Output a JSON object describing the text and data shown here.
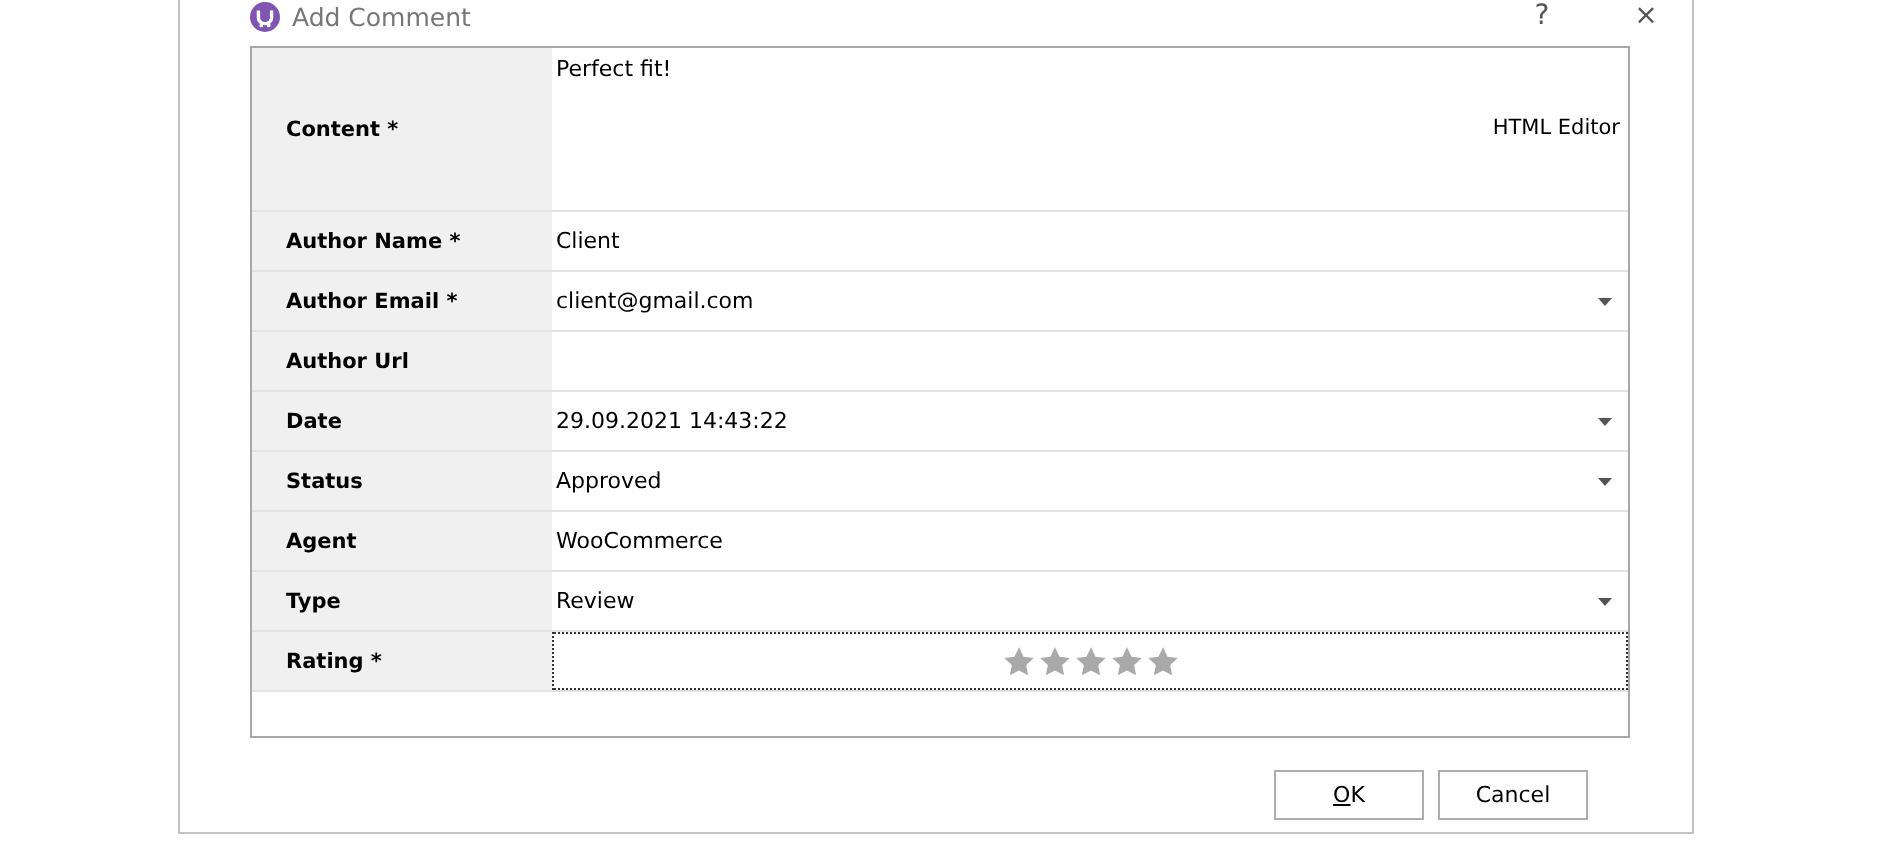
{
  "window": {
    "title": "Add Comment",
    "help": "?",
    "close": "×"
  },
  "content": {
    "label": "Content *",
    "value": "Perfect fit!",
    "editor_link": "HTML Editor"
  },
  "fields": [
    {
      "label": "Author Name *",
      "value": "Client",
      "kind": "text"
    },
    {
      "label": "Author Email *",
      "value": "client@gmail.com",
      "kind": "dropdown"
    },
    {
      "label": "Author Url",
      "kind": "text"
    },
    {
      "label": "Date",
      "value": "29.09.2021 14:43:22",
      "kind": "dropdown"
    },
    {
      "label": "Status",
      "value": "Approved",
      "kind": "dropdown"
    },
    {
      "label": "Agent",
      "value": "WooCommerce",
      "kind": "text"
    },
    {
      "label": "Type",
      "value": "Review",
      "kind": "dropdown"
    },
    {
      "label": "Rating *",
      "kind": "rating",
      "stars": 0
    }
  ],
  "buttons": [
    {
      "label": "OK",
      "underline_first": true
    },
    {
      "label": "Cancel",
      "underline_first": false
    }
  ]
}
